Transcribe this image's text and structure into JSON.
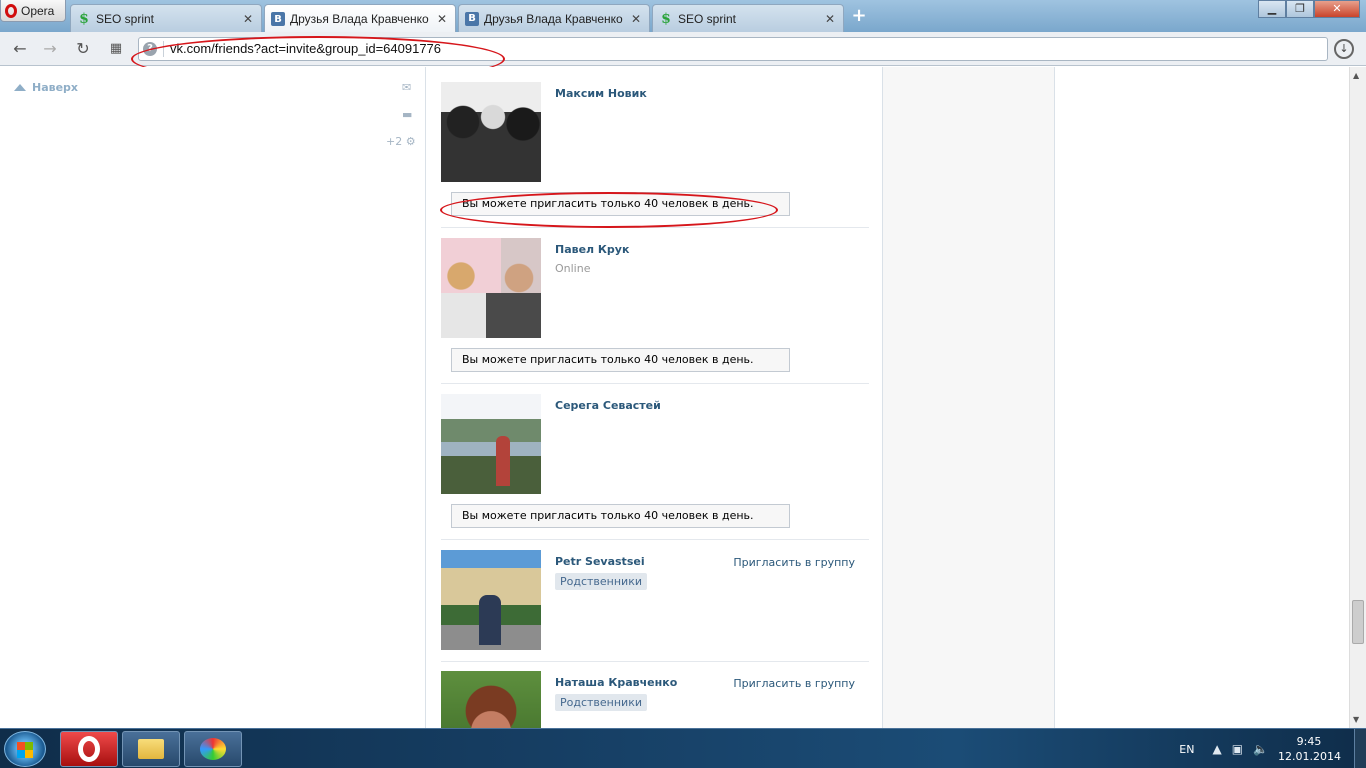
{
  "browser": {
    "menu_label": "Opera",
    "tabs": [
      {
        "title": "SEO sprint",
        "icon": "seo-sprint-favicon",
        "active": false
      },
      {
        "title": "Друзья Влада Кравченко",
        "icon": "vk-favicon",
        "active": true
      },
      {
        "title": "Друзья Влада Кравченко",
        "icon": "vk-favicon",
        "active": false
      },
      {
        "title": "SEO sprint",
        "icon": "seo-sprint-favicon",
        "active": false
      }
    ],
    "close_glyph": "✕",
    "new_tab_glyph": "+",
    "address_url": "vk.com/friends?act=invite&group_id=64091776",
    "address_info_glyph": "?",
    "download_glyph": "↓"
  },
  "sidebar": {
    "up_label": "Наверх",
    "notification_count": "+2"
  },
  "friends": [
    {
      "name": "Максим Новик",
      "status": "",
      "tag": "",
      "invite": "",
      "notice": "Вы можете пригласить только 40 человек в день.",
      "photo": "ph-maxim"
    },
    {
      "name": "Павел Крук",
      "status": "Online",
      "tag": "",
      "invite": "",
      "notice": "Вы можете пригласить только 40 человек в день.",
      "photo": "ph-pavel"
    },
    {
      "name": "Серега Севастей",
      "status": "",
      "tag": "",
      "invite": "",
      "notice": "Вы можете пригласить только 40 человек в день.",
      "photo": "ph-serega"
    },
    {
      "name": "Petr Sevastsei",
      "status": "",
      "tag": "Родственники",
      "invite": "Пригласить в группу",
      "notice": "",
      "photo": "ph-petr"
    },
    {
      "name": "Наташа Кравченко",
      "status": "",
      "tag": "Родственники",
      "invite": "Пригласить в группу",
      "notice": "",
      "photo": "ph-natasha"
    }
  ],
  "taskbar": {
    "language": "EN",
    "time": "9:45",
    "date": "12.01.2014"
  },
  "colors": {
    "vk_link": "#2b587a",
    "annotation_red": "#d6161b"
  }
}
